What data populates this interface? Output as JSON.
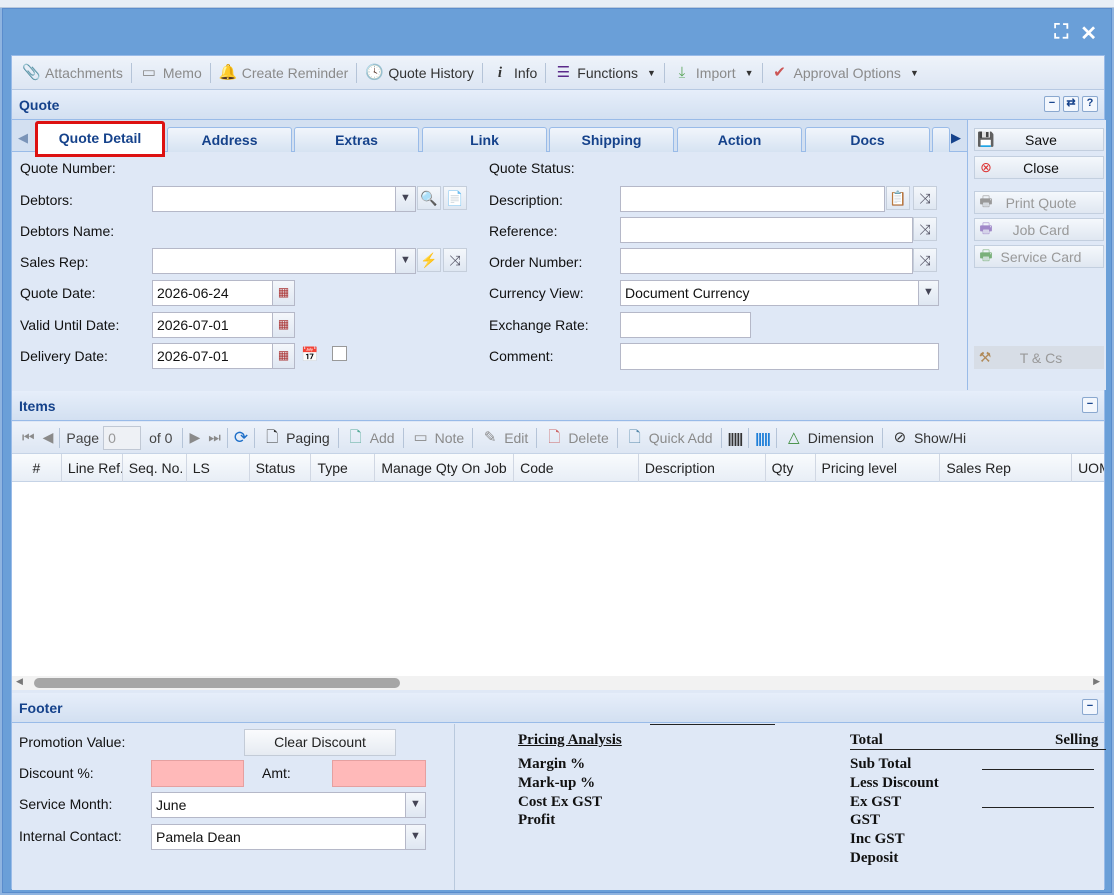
{
  "window": {
    "maximize_icon": "maximize-icon",
    "close_icon": "close-icon"
  },
  "toolbar": {
    "attachments": "Attachments",
    "memo": "Memo",
    "create_reminder": "Create Reminder",
    "quote_history": "Quote History",
    "info": "Info",
    "functions": "Functions",
    "import": "Import",
    "approval_options": "Approval Options"
  },
  "quote_panel": {
    "title": "Quote"
  },
  "tabs": [
    "Quote Detail",
    "Address",
    "Extras",
    "Link",
    "Shipping",
    "Action",
    "Docs"
  ],
  "form": {
    "quote_number_label": "Quote Number:",
    "debtors_label": "Debtors:",
    "debtors_value": "",
    "debtors_name_label": "Debtors Name:",
    "sales_rep_label": "Sales Rep:",
    "sales_rep_value": "",
    "quote_date_label": "Quote Date:",
    "quote_date_value": "2026-06-24",
    "valid_until_label": "Valid Until Date:",
    "valid_until_value": "2026-07-01",
    "delivery_date_label": "Delivery Date:",
    "delivery_date_value": "2026-07-01",
    "quote_status_label": "Quote Status:",
    "description_label": "Description:",
    "description_value": "",
    "reference_label": "Reference:",
    "reference_value": "",
    "order_number_label": "Order Number:",
    "order_number_value": "",
    "currency_view_label": "Currency View:",
    "currency_view_value": "Document Currency",
    "exchange_rate_label": "Exchange Rate:",
    "exchange_rate_value": "",
    "comment_label": "Comment:",
    "comment_value": ""
  },
  "side": {
    "save": "Save",
    "close": "Close",
    "print_quote": "Print Quote",
    "job_card": "Job Card",
    "service_card": "Service Card",
    "tcs": "T & Cs"
  },
  "items_panel": {
    "title": "Items"
  },
  "items_toolbar": {
    "page_label": "Page",
    "page_value": "0",
    "of_label": "of 0",
    "paging": "Paging",
    "add": "Add",
    "note": "Note",
    "edit": "Edit",
    "delete": "Delete",
    "quick_add": "Quick Add",
    "dimension": "Dimension",
    "show_hide": "Show/Hi"
  },
  "grid": {
    "columns": [
      "#",
      "Line Ref.",
      "Seq. No.",
      "LS",
      "Status",
      "Type",
      "Manage Qty On Job",
      "Code",
      "Description",
      "Qty",
      "Pricing level",
      "Sales Rep",
      "UOM"
    ]
  },
  "footer_panel": {
    "title": "Footer"
  },
  "footer": {
    "promotion_label": "Promotion Value:",
    "clear_discount": "Clear Discount",
    "discount_label": "Discount %:",
    "amt_label": "Amt:",
    "service_month_label": "Service Month:",
    "service_month_value": "June",
    "internal_contact_label": "Internal Contact:",
    "internal_contact_value": "Pamela Dean",
    "pricing_analysis": "Pricing Analysis",
    "margin": "Margin %",
    "markup": "Mark-up %",
    "cost_ex_gst": "Cost Ex GST",
    "profit": "Profit",
    "total": "Total",
    "selling": "Selling",
    "sub_total": "Sub Total",
    "less_discount": "Less Discount",
    "ex_gst": "Ex GST",
    "gst": "GST",
    "inc_gst": "Inc GST",
    "deposit": "Deposit"
  }
}
